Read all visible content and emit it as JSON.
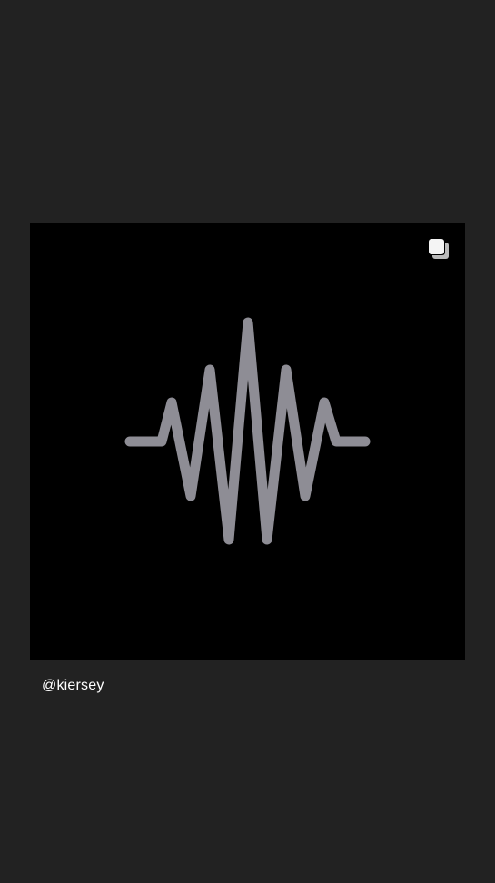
{
  "post": {
    "author_handle": "@kiersey",
    "media_icon": "multiple-images-icon",
    "artwork_icon": "sound-wave-icon"
  },
  "colors": {
    "background": "#222222",
    "card": "#000000",
    "waveform": "#8e8d95",
    "text": "#ffffff"
  }
}
